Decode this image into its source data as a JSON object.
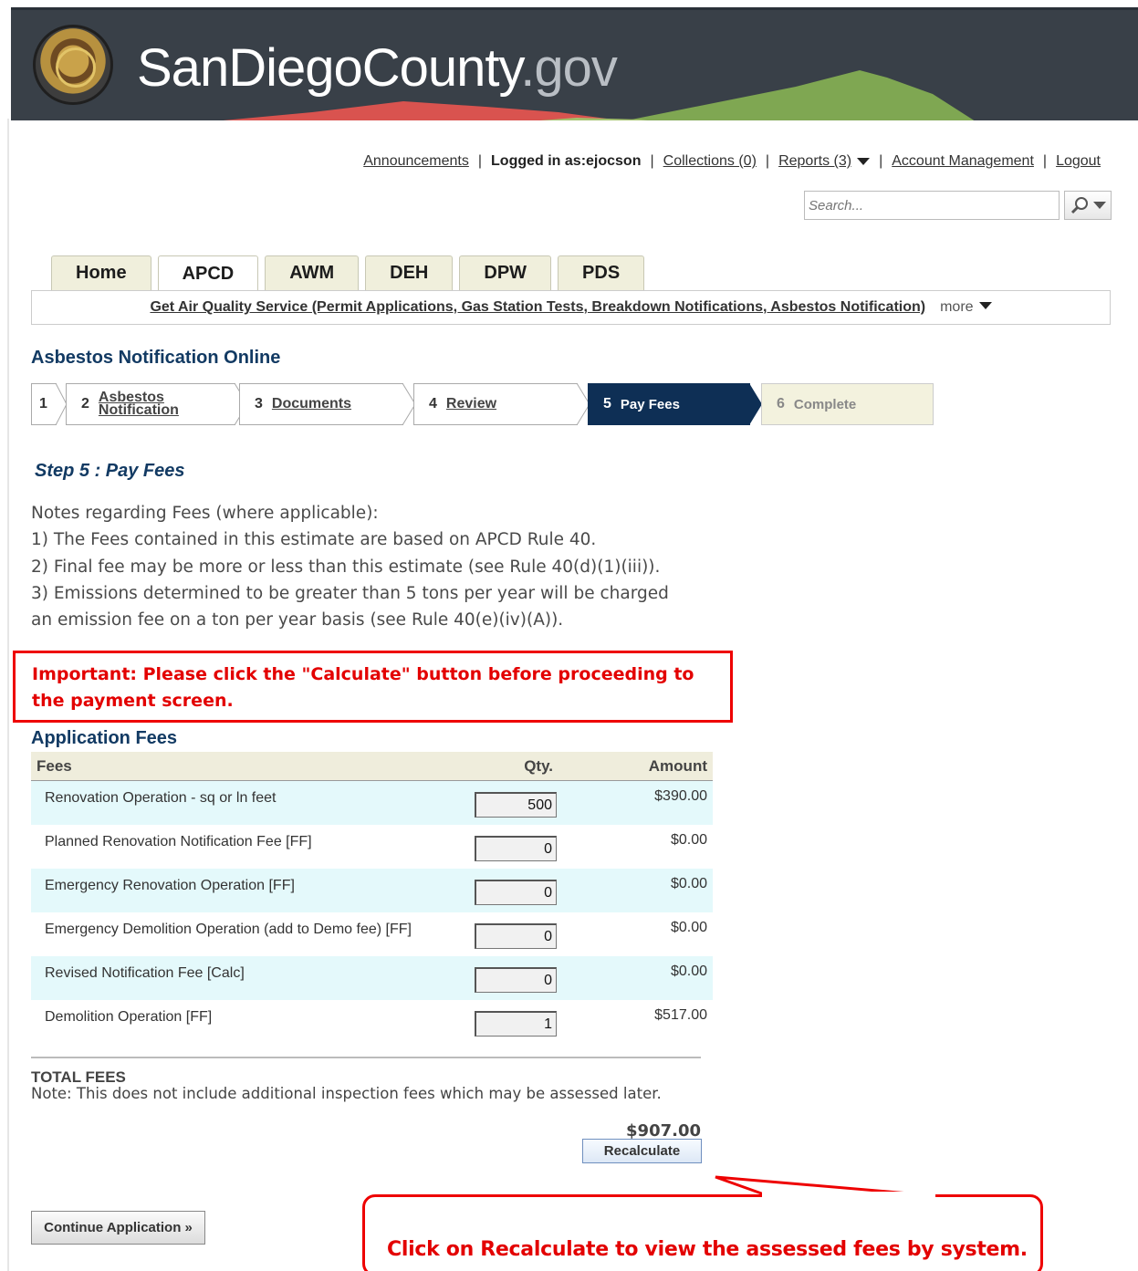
{
  "header": {
    "logo_main": "SanDiegoCounty",
    "logo_suffix": ".gov"
  },
  "toplinks": {
    "announcements": "Announcements",
    "logged_in_label": "Logged in as:",
    "username": "ejocson",
    "collections": "Collections (0)",
    "reports": "Reports (3)",
    "account": "Account Management",
    "logout": "Logout"
  },
  "search": {
    "placeholder": "Search..."
  },
  "tabs": [
    "Home",
    "APCD",
    "AWM",
    "DEH",
    "DPW",
    "PDS"
  ],
  "subnav": {
    "link": "Get Air Quality Service (Permit Applications, Gas Station Tests, Breakdown Notifications, Asbestos Notification)",
    "more": "more"
  },
  "page_title": "Asbestos Notification Online",
  "steps": [
    {
      "num": "1",
      "label": ""
    },
    {
      "num": "2",
      "label_line1": "Asbestos",
      "label_line2": "Notification"
    },
    {
      "num": "3",
      "label": "Documents"
    },
    {
      "num": "4",
      "label": "Review"
    },
    {
      "num": "5",
      "label": "Pay Fees"
    },
    {
      "num": "6",
      "label": "Complete"
    }
  ],
  "step_title": "Step 5 : Pay Fees",
  "notes": [
    "Notes regarding Fees (where applicable):",
    "1) The Fees contained in this estimate are based on APCD Rule 40.",
    "2) Final fee may be more or less than this estimate (see Rule 40(d)(1)(iii)).",
    "3) Emissions determined to be greater than 5 tons per year will be charged",
    "an emission fee on a ton per year basis (see Rule 40(e)(iv)(A))."
  ],
  "important": {
    "line1": "Important: Please click the \"Calculate\" button before proceeding to",
    "line2": "the payment screen."
  },
  "application_fees": {
    "title": "Application Fees",
    "headers": {
      "fees": "Fees",
      "qty": "Qty.",
      "amount": "Amount"
    },
    "rows": [
      {
        "name": "Renovation Operation - sq or ln feet",
        "qty": "500",
        "amount": "$390.00"
      },
      {
        "name": "Planned Renovation Notification Fee [FF]",
        "qty": "0",
        "amount": "$0.00"
      },
      {
        "name": "Emergency Renovation Operation [FF]",
        "qty": "0",
        "amount": "$0.00"
      },
      {
        "name": "Emergency Demolition Operation (add to Demo fee) [FF]",
        "qty": "0",
        "amount": "$0.00"
      },
      {
        "name": "Revised Notification Fee [Calc]",
        "qty": "0",
        "amount": "$0.00"
      },
      {
        "name": "Demolition Operation [FF]",
        "qty": "1",
        "amount": "$517.00"
      }
    ]
  },
  "total": {
    "label": "TOTAL FEES",
    "note": "Note: This does not include additional inspection fees which may be assessed later.",
    "amount": "$907.00",
    "recalc_label": "Recalculate"
  },
  "continue_label": "Continue Application »",
  "callout": "Click on Recalculate to view the assessed fees by system.",
  "colors": {
    "accent_navy": "#0e2f55",
    "annotation_red": "#e30000",
    "row_alt": "#e4f9fb",
    "tab_bg": "#f0efdc"
  }
}
